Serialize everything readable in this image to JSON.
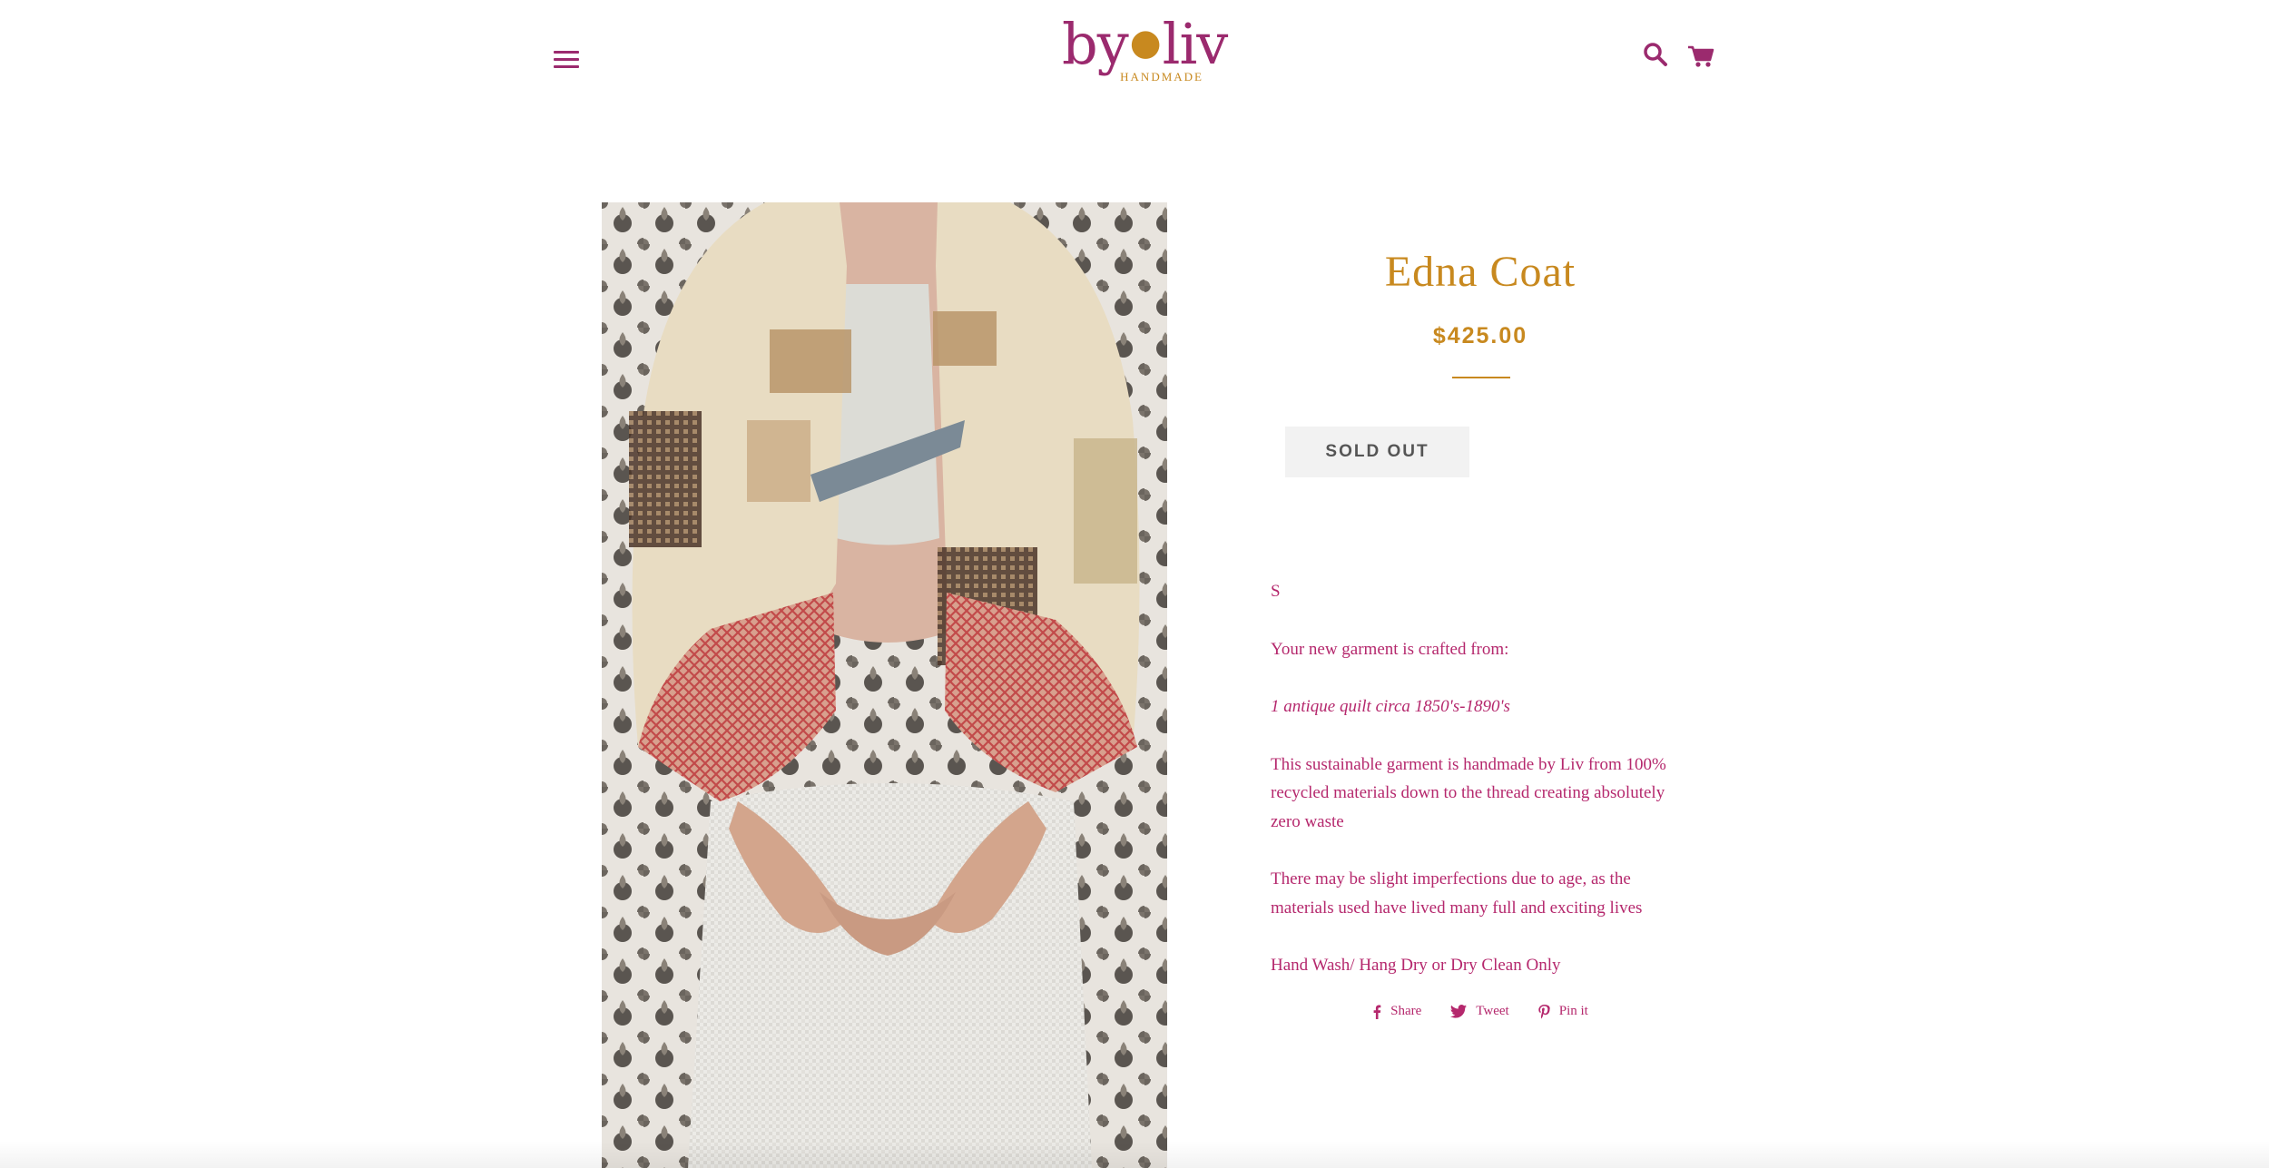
{
  "header": {
    "logo_text": "by·liv",
    "logo_word_left": "by",
    "logo_word_right": "liv",
    "logo_sub": "HANDMADE",
    "menu_icon": "hamburger-menu-icon",
    "search_icon": "search-icon",
    "cart_icon": "cart-icon"
  },
  "colors": {
    "brand": "#9b2a6e",
    "accent_gold": "#c8891f",
    "text_pink": "#b5286d",
    "button_bg": "#f2f2f2"
  },
  "product": {
    "title": "Edna Coat",
    "price": "$425.00",
    "button_label": "SOLD OUT",
    "description": [
      "S",
      "Your new garment is crafted from:",
      "1 antique quilt circa 1850's-1890's",
      "This sustainable garment is handmade by Liv from 100% recycled materials down to the thread creating absolutely zero waste",
      "There may be slight imperfections due to age, as the materials used have lived many full and exciting lives",
      "Hand Wash/ Hang Dry or Dry Clean Only"
    ]
  },
  "social": {
    "share": "Share",
    "tweet": "Tweet",
    "pin": "Pin it"
  }
}
